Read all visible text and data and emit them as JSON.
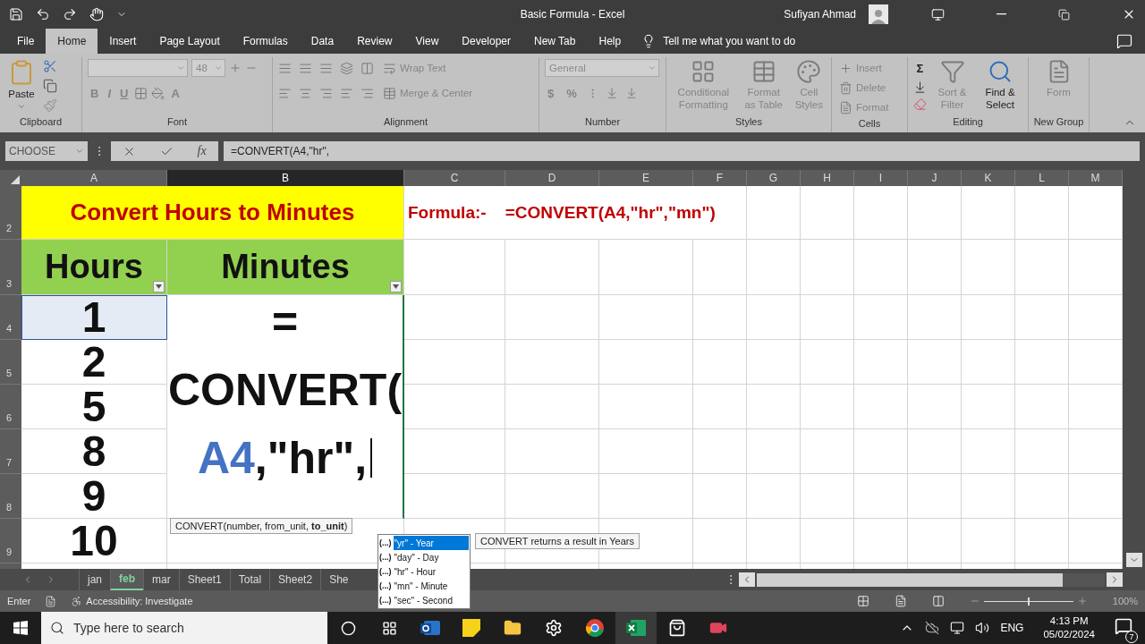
{
  "window": {
    "title": "Basic Formula  -  Excel",
    "user": "Sufiyan Ahmad"
  },
  "menu_tabs": [
    {
      "label": "File",
      "selected": false
    },
    {
      "label": "Home",
      "selected": true
    },
    {
      "label": "Insert",
      "selected": false
    },
    {
      "label": "Page Layout",
      "selected": false
    },
    {
      "label": "Formulas",
      "selected": false
    },
    {
      "label": "Data",
      "selected": false
    },
    {
      "label": "Review",
      "selected": false
    },
    {
      "label": "View",
      "selected": false
    },
    {
      "label": "Developer",
      "selected": false
    },
    {
      "label": "New Tab",
      "selected": false
    },
    {
      "label": "Help",
      "selected": false
    }
  ],
  "tell_me": "Tell me what you want to do",
  "ribbon": [
    {
      "kind": "clipboard",
      "label": "Clipboard",
      "buttons": [
        {
          "label": "Paste",
          "disabled": false
        }
      ]
    },
    {
      "kind": "font",
      "label": "Font",
      "buttons": [
        {
          "label": "48",
          "disabled": true
        },
        {
          "label": "B",
          "disabled": true
        },
        {
          "label": "I",
          "disabled": true
        },
        {
          "label": "U",
          "disabled": true
        },
        {
          "label": "A",
          "disabled": true
        }
      ]
    },
    {
      "kind": "alignment",
      "label": "Alignment",
      "buttons": [
        {
          "label": "Wrap Text",
          "disabled": true
        },
        {
          "label": "Merge & Center",
          "disabled": true
        }
      ]
    },
    {
      "kind": "number",
      "label": "Number",
      "buttons": [
        {
          "label": "General",
          "disabled": true
        },
        {
          "label": "$",
          "disabled": true
        },
        {
          "label": "%",
          "disabled": true
        }
      ]
    },
    {
      "kind": "styles",
      "label": "Styles",
      "buttons": [
        {
          "label": "Conditional Formatting",
          "disabled": true
        },
        {
          "label": "Format as Table",
          "disabled": true
        },
        {
          "label": "Cell Styles",
          "disabled": true
        }
      ]
    },
    {
      "kind": "cells",
      "label": "Cells",
      "buttons": [
        {
          "label": "Insert",
          "disabled": true
        },
        {
          "label": "Delete",
          "disabled": true
        },
        {
          "label": "Format",
          "disabled": true
        }
      ]
    },
    {
      "kind": "editing",
      "label": "Editing",
      "buttons": [
        {
          "label": "Σ",
          "disabled": false
        },
        {
          "label": "Sort & Filter",
          "disabled": true
        },
        {
          "label": "Find & Select",
          "disabled": false
        }
      ]
    },
    {
      "kind": "custom",
      "label": "New Group",
      "buttons": [
        {
          "label": "Form",
          "disabled": true
        }
      ]
    }
  ],
  "formula_bar": {
    "name_box": "CHOOSE",
    "function_button": "fx",
    "formula": "=CONVERT(A4,\"hr\","
  },
  "sheet": {
    "columns": [
      {
        "label": "A",
        "selected": false
      },
      {
        "label": "B",
        "selected": true
      },
      {
        "label": "C",
        "selected": false
      },
      {
        "label": "D",
        "selected": false
      },
      {
        "label": "E",
        "selected": false
      },
      {
        "label": "F",
        "selected": false
      },
      {
        "label": "G",
        "selected": false
      },
      {
        "label": "H",
        "selected": false
      },
      {
        "label": "I",
        "selected": false
      },
      {
        "label": "J",
        "selected": false
      },
      {
        "label": "K",
        "selected": false
      },
      {
        "label": "L",
        "selected": false
      },
      {
        "label": "M",
        "selected": false
      }
    ],
    "rows": [
      "2",
      "3",
      "4",
      "5",
      "6",
      "7",
      "8",
      "9"
    ],
    "title_cell": "Convert Hours to Minutes",
    "formula_note": "Formula:-    =CONVERT(A4,\"hr\",\"mn\")",
    "headers": [
      "Hours",
      "Minutes"
    ],
    "hours": [
      {
        "value": "1",
        "highlighted": true
      },
      {
        "value": "2",
        "highlighted": false
      },
      {
        "value": "5",
        "highlighted": false
      },
      {
        "value": "8",
        "highlighted": false
      },
      {
        "value": "9",
        "highlighted": false
      },
      {
        "value": "10",
        "highlighted": false
      }
    ],
    "edit_lines": [
      {
        "parts": [
          {
            "kind": "plain",
            "text": "="
          }
        ]
      },
      {
        "parts": [
          {
            "kind": "plain",
            "text": "CONVERT("
          }
        ]
      },
      {
        "parts": [
          {
            "kind": "reference",
            "text": "A4"
          },
          {
            "kind": "plain",
            "text": ",\"hr\","
          }
        ]
      }
    ]
  },
  "syntax_tip": "CONVERT(number, from_unit, **to_unit**)",
  "autocomplete": [
    {
      "icon": "(...)",
      "label": "\"yr\" - Year",
      "selected": true
    },
    {
      "icon": "(...)",
      "label": "\"day\" - Day",
      "selected": false
    },
    {
      "icon": "(...)",
      "label": "\"hr\" - Hour",
      "selected": false
    },
    {
      "icon": "(...)",
      "label": "\"mn\" - Minute",
      "selected": false
    },
    {
      "icon": "(...)",
      "label": "\"sec\" - Second",
      "selected": false
    }
  ],
  "autocomplete_tip": "CONVERT returns a result in Years",
  "sheet_tabs": [
    {
      "label": "jan",
      "selected": false
    },
    {
      "label": "feb",
      "selected": true
    },
    {
      "label": "mar",
      "selected": false
    },
    {
      "label": "Sheet1",
      "selected": false
    },
    {
      "label": "Total",
      "selected": false
    },
    {
      "label": "Sheet2",
      "selected": false
    },
    {
      "label": "She",
      "selected": false
    }
  ],
  "status_bar": {
    "mode": "Enter",
    "accessibility": "Accessibility: Investigate",
    "zoom_slider": {
      "level": 0.5
    },
    "zoom": "100%"
  },
  "taskbar": {
    "search_placeholder": "Type here to search",
    "language": "ENG",
    "time": "4:13 PM",
    "date": "05/02/2024",
    "notifications": "7"
  }
}
